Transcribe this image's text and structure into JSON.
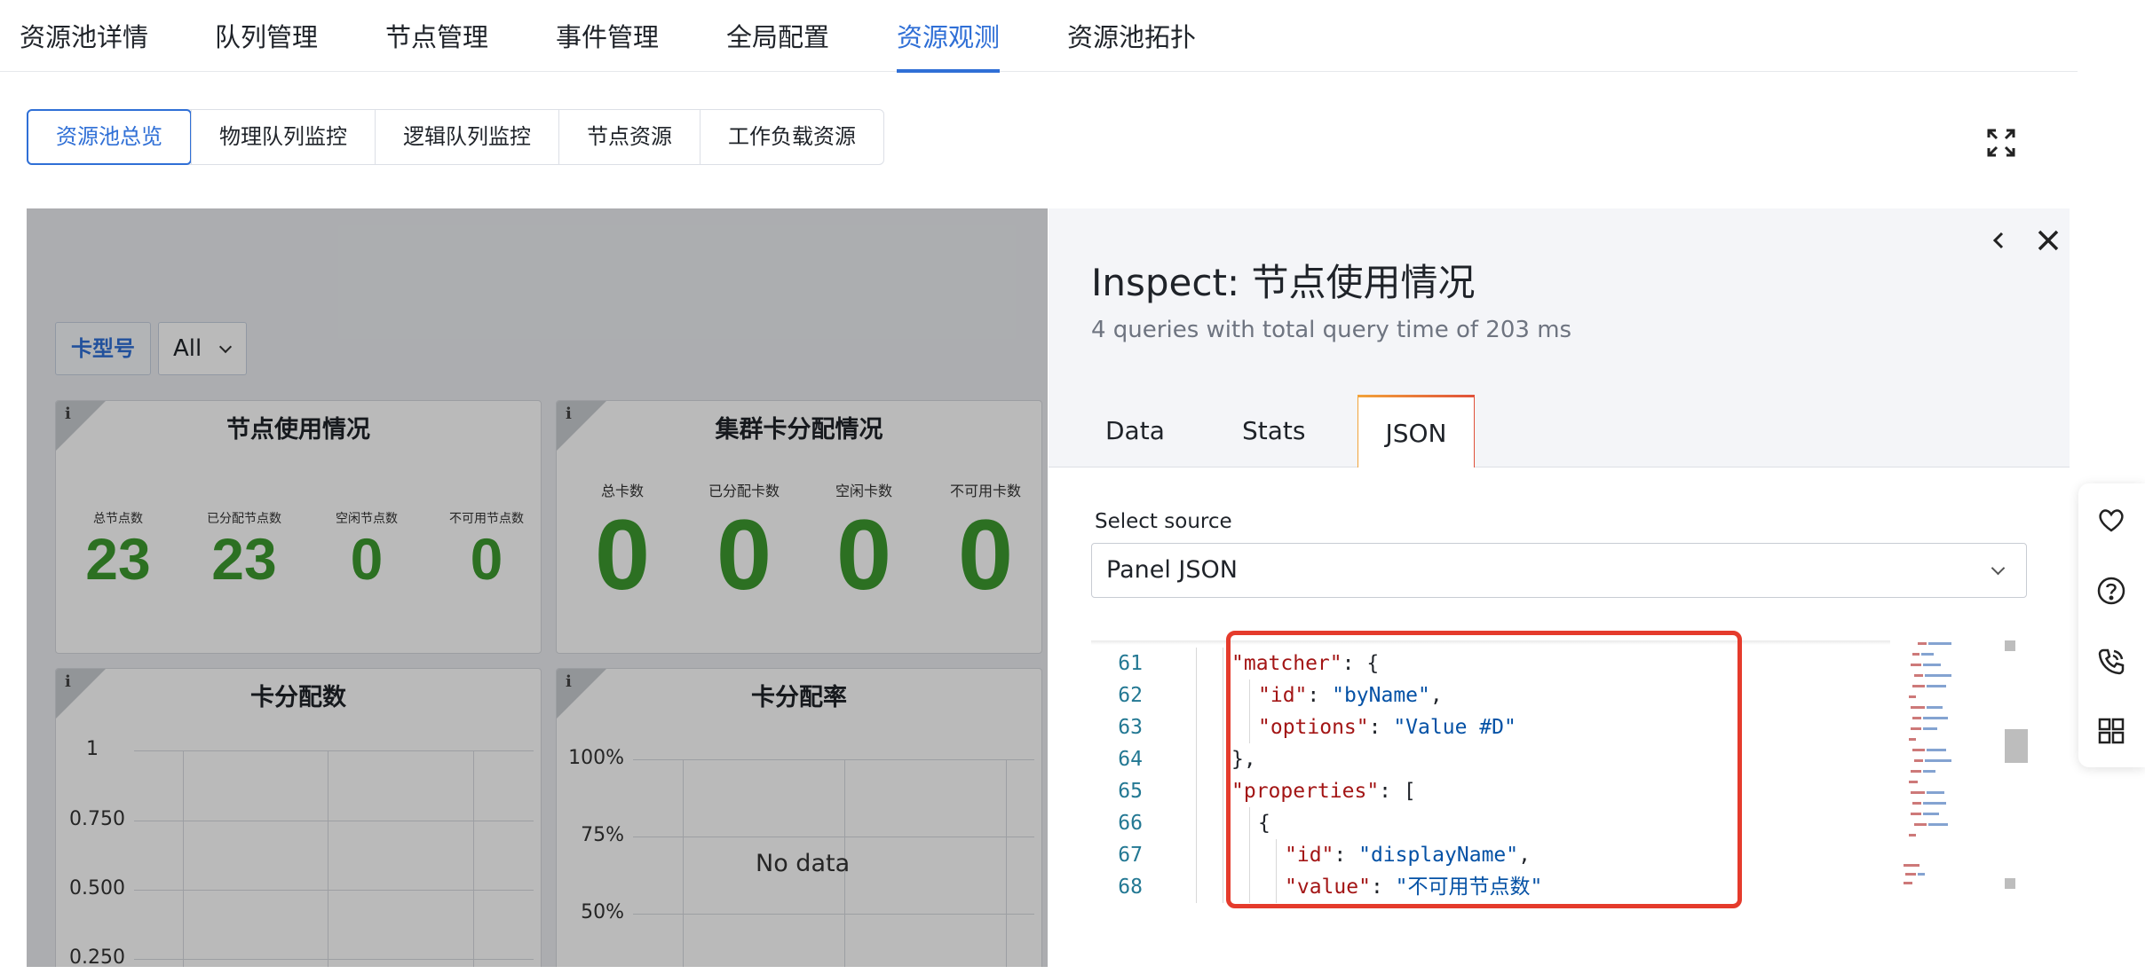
{
  "top_tabs": [
    "资源池详情",
    "队列管理",
    "节点管理",
    "事件管理",
    "全局配置",
    "资源观测",
    "资源池拓扑"
  ],
  "active_top_tab": "资源观测",
  "sub_tabs": [
    "资源池总览",
    "物理队列监控",
    "逻辑队列监控",
    "节点资源",
    "工作负载资源"
  ],
  "active_sub_tab": "资源池总览",
  "dashboard": {
    "variable_label": "卡型号",
    "variable_value": "All",
    "panels": [
      {
        "title": "节点使用情况",
        "stats": [
          {
            "label": "总节点数",
            "value": "23"
          },
          {
            "label": "已分配节点数",
            "value": "23"
          },
          {
            "label": "空闲节点数",
            "value": "0"
          },
          {
            "label": "不可用节点数",
            "value": "0"
          }
        ]
      },
      {
        "title": "集群卡分配情况",
        "stats": [
          {
            "label": "总卡数",
            "value": "0"
          },
          {
            "label": "已分配卡数",
            "value": "0"
          },
          {
            "label": "空闲卡数",
            "value": "0"
          },
          {
            "label": "不可用卡数",
            "value": "0"
          }
        ]
      },
      {
        "title": "卡分配数",
        "y_ticks": [
          "1",
          "0.750",
          "0.500",
          "0.250"
        ]
      },
      {
        "title": "卡分配率",
        "y_ticks": [
          "100%",
          "75%",
          "50%"
        ],
        "no_data": "No data"
      }
    ]
  },
  "inspect": {
    "title": "Inspect: 节点使用情况",
    "subtitle": "4 queries with total query time of 203 ms",
    "tabs": [
      "Data",
      "Stats",
      "JSON"
    ],
    "active_tab": "JSON",
    "select_source_label": "Select source",
    "select_source_value": "Panel JSON",
    "code_lines": [
      {
        "n": "61",
        "indent": 2,
        "parts": [
          [
            "k",
            "\"matcher\""
          ],
          [
            "p",
            ": {"
          ]
        ]
      },
      {
        "n": "62",
        "indent": 3,
        "parts": [
          [
            "k",
            "\"id\""
          ],
          [
            "p",
            ": "
          ],
          [
            "s",
            "\"byName\""
          ],
          [
            "p",
            ","
          ]
        ]
      },
      {
        "n": "63",
        "indent": 3,
        "parts": [
          [
            "k",
            "\"options\""
          ],
          [
            "p",
            ": "
          ],
          [
            "s",
            "\"Value #D\""
          ]
        ]
      },
      {
        "n": "64",
        "indent": 2,
        "parts": [
          [
            "p",
            "},"
          ]
        ]
      },
      {
        "n": "65",
        "indent": 2,
        "parts": [
          [
            "k",
            "\"properties\""
          ],
          [
            "p",
            ": ["
          ]
        ]
      },
      {
        "n": "66",
        "indent": 3,
        "parts": [
          [
            "p",
            "{"
          ]
        ]
      },
      {
        "n": "67",
        "indent": 4,
        "parts": [
          [
            "k",
            "\"id\""
          ],
          [
            "p",
            ": "
          ],
          [
            "s",
            "\"displayName\""
          ],
          [
            "p",
            ","
          ]
        ]
      },
      {
        "n": "68",
        "indent": 4,
        "parts": [
          [
            "k",
            "\"value\""
          ],
          [
            "p",
            ": "
          ],
          [
            "s",
            "\"不可用节点数\""
          ]
        ]
      }
    ]
  },
  "icons": {
    "fullscreen": "expand-icon",
    "drawer_collapse": "chevron-left-icon",
    "drawer_close": "close-icon",
    "float_bar": [
      "heart-icon",
      "help-icon",
      "phone-icon",
      "apps-grid-icon"
    ]
  },
  "colors": {
    "accent": "#2f6fd6",
    "stat_green": "#3d9a2f",
    "highlight_red": "#e53b2c"
  }
}
